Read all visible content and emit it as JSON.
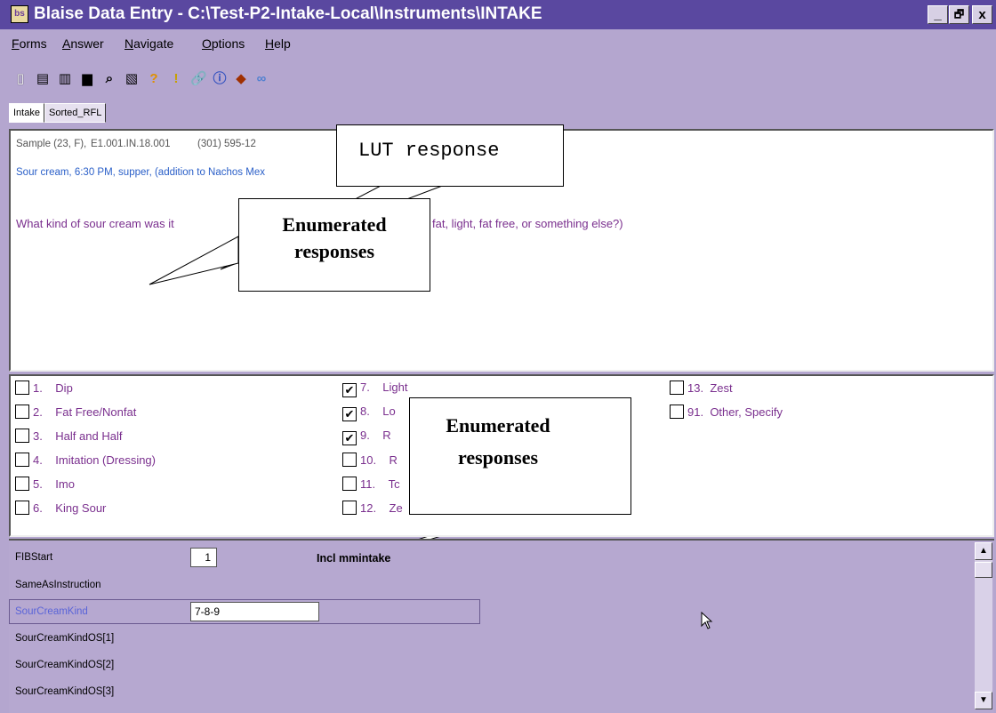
{
  "window": {
    "title": "Blaise Data Entry - C:\\Test-P2-Intake-Local\\Instruments\\INTAKE",
    "icon_text": "bs"
  },
  "window_buttons": {
    "minimize": "_",
    "maximize": "🗗",
    "close": "x"
  },
  "menu": [
    "Forms",
    "Answer",
    "Navigate",
    "Options",
    "Help"
  ],
  "toolbar_icons": [
    "new-form-icon",
    "open-form-icon",
    "copy-icon",
    "save-icon",
    "find-icon",
    "preview-icon",
    "help-icon",
    "alert-icon",
    "attach-icon",
    "info-icon",
    "edit-icon",
    "link-icon"
  ],
  "tabs": [
    "Intake",
    "Sorted_RFL"
  ],
  "question": {
    "header_left": "Sample (23, F),",
    "header_id": "E1.001.IN.18.001",
    "header_phone": "(301) 595-12",
    "food_line": "Sour cream, 6:30 PM, supper, (addition to Nachos Mex",
    "prompt_start": "What kind of sour cream was it",
    "prompt_end": "fat, light, fat free, or something else?)"
  },
  "callouts": {
    "lut": "LUT response",
    "enum_top_1": "Enumerated",
    "enum_top_2": "responses",
    "enum_bottom_1": "Enumerated",
    "enum_bottom_2": "responses"
  },
  "options": {
    "col1": [
      {
        "num": "1.",
        "label": "Dip",
        "checked": false
      },
      {
        "num": "2.",
        "label": "Fat Free/Nonfat",
        "checked": false
      },
      {
        "num": "3.",
        "label": "Half and Half",
        "checked": false
      },
      {
        "num": "4.",
        "label": "Imitation (Dressing)",
        "checked": false
      },
      {
        "num": "5.",
        "label": "Imo",
        "checked": false
      },
      {
        "num": "6.",
        "label": "King Sour",
        "checked": false
      }
    ],
    "col2": [
      {
        "num": "7.",
        "label": "Light",
        "checked": true
      },
      {
        "num": "8.",
        "label": "Lo",
        "checked": true
      },
      {
        "num": "9.",
        "label": "R",
        "checked": true
      },
      {
        "num": "10.",
        "label": "R",
        "checked": false
      },
      {
        "num": "11.",
        "label": "Tc",
        "checked": false
      },
      {
        "num": "12.",
        "label": "Ze",
        "checked": false
      }
    ],
    "col3": [
      {
        "num": "13.",
        "label": "Zest",
        "checked": false
      },
      {
        "num": "91.",
        "label": "Other, Specify",
        "checked": false
      }
    ]
  },
  "form": {
    "fields": [
      {
        "name": "FIBStart",
        "value": "1",
        "extra": "Incl mmintake"
      },
      {
        "name": "SameAsInstruction",
        "value": "",
        "extra": ""
      },
      {
        "name": "SourCreamKind",
        "value": "7-8-9",
        "extra": ""
      },
      {
        "name": "SourCreamKindOS[1]",
        "value": "",
        "extra": ""
      },
      {
        "name": "SourCreamKindOS[2]",
        "value": "",
        "extra": ""
      },
      {
        "name": "SourCreamKindOS[3]",
        "value": "",
        "extra": ""
      }
    ]
  },
  "colors": {
    "titlebar": "#5a48a0",
    "background": "#b4a6cf",
    "question_text": "#7a2f8e",
    "link_text": "#2a5fc8"
  }
}
